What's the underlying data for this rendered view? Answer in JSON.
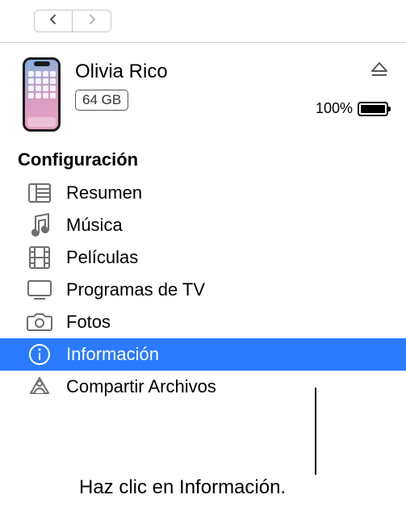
{
  "device": {
    "name": "Olivia Rico",
    "storage": "64 GB",
    "battery_percent": "100%"
  },
  "section_title": "Configuración",
  "sidebar": {
    "items": [
      {
        "label": "Resumen",
        "icon": "summary-icon"
      },
      {
        "label": "Música",
        "icon": "music-icon"
      },
      {
        "label": "Películas",
        "icon": "movies-icon"
      },
      {
        "label": "Programas de TV",
        "icon": "tv-icon"
      },
      {
        "label": "Fotos",
        "icon": "photos-icon"
      },
      {
        "label": "Información",
        "icon": "info-icon",
        "selected": true
      },
      {
        "label": "Compartir Archivos",
        "icon": "file-sharing-icon"
      }
    ]
  },
  "callout": "Haz clic en Información."
}
